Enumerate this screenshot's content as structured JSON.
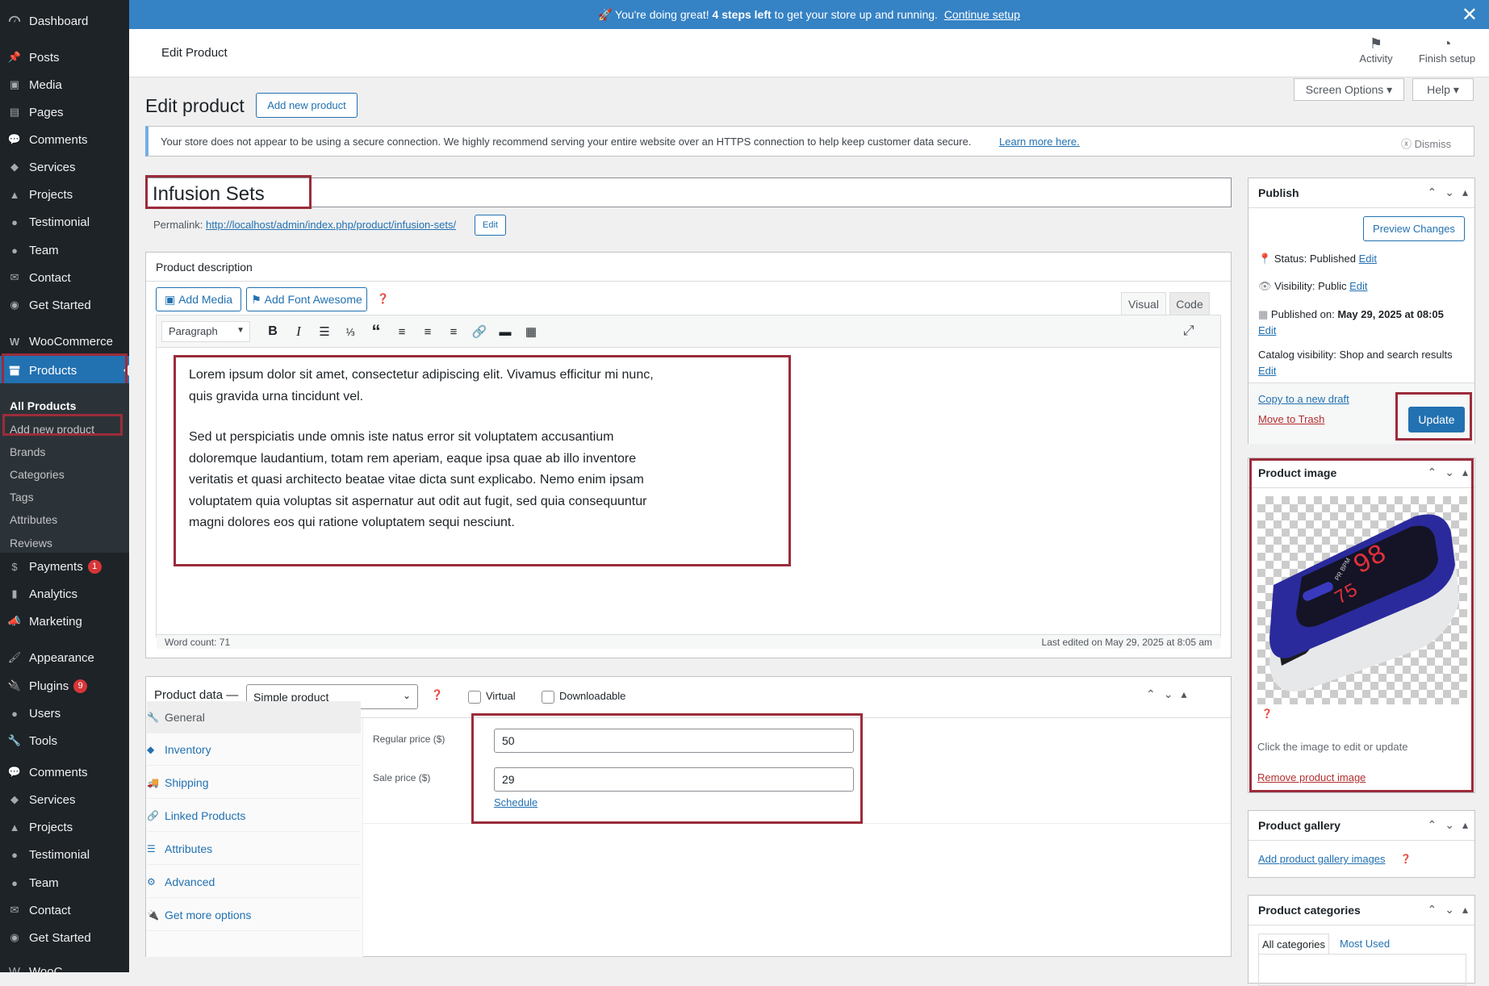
{
  "sidebar": {
    "top": [
      {
        "label": "Dashboard",
        "icon": "dashboard-icon"
      }
    ],
    "group1": [
      {
        "label": "Posts",
        "icon": "pin-icon"
      },
      {
        "label": "Media",
        "icon": "media-icon"
      },
      {
        "label": "Pages",
        "icon": "pages-icon"
      },
      {
        "label": "Comments",
        "icon": "comment-icon"
      },
      {
        "label": "Services",
        "icon": "tag-icon"
      },
      {
        "label": "Projects",
        "icon": "cap-icon"
      },
      {
        "label": "Testimonial",
        "icon": "person-icon"
      },
      {
        "label": "Team",
        "icon": "person-icon"
      },
      {
        "label": "Contact",
        "icon": "mail-icon"
      },
      {
        "label": "Get Started",
        "icon": "globe-icon"
      }
    ],
    "woo": "WooCommerce",
    "products": "Products",
    "products_sub": [
      "All Products",
      "Add new product",
      "Brands",
      "Categories",
      "Tags",
      "Attributes",
      "Reviews"
    ],
    "group2": [
      {
        "label": "Payments",
        "badge": "1"
      },
      {
        "label": "Analytics"
      },
      {
        "label": "Marketing"
      }
    ],
    "group3": [
      {
        "label": "Appearance"
      },
      {
        "label": "Plugins",
        "badge": "9"
      },
      {
        "label": "Users"
      },
      {
        "label": "Tools"
      }
    ],
    "group4": [
      {
        "label": "Comments"
      },
      {
        "label": "Services"
      },
      {
        "label": "Projects"
      },
      {
        "label": "Testimonial"
      },
      {
        "label": "Team"
      },
      {
        "label": "Contact"
      },
      {
        "label": "Get Started"
      }
    ],
    "bottom_cut": "WooC"
  },
  "banner": {
    "pre": "🚀 You're doing great! ",
    "bold": "4 steps left",
    "post": " to get your store up and running. ",
    "link": "Continue setup"
  },
  "header": {
    "title": "Edit Product",
    "activity": "Activity",
    "finish": "Finish setup"
  },
  "page": {
    "heading": "Edit product",
    "add_new": "Add new product",
    "screen_options": "Screen Options ▾",
    "help": "Help ▾"
  },
  "notice": {
    "text": "Your store does not appear to be using a secure connection. We highly recommend serving your entire website over an HTTPS connection to help keep customer data secure.",
    "link": "Learn more here.",
    "dismiss": "Dismiss"
  },
  "product": {
    "title": "Infusion Sets",
    "permalink_label": "Permalink:",
    "permalink": "http://localhost/admin/index.php/product/infusion-sets/",
    "edit": "Edit"
  },
  "desc": {
    "heading": "Product description",
    "add_media": "Add Media",
    "add_fa": "Add Font Awesome",
    "tab_visual": "Visual",
    "tab_code": "Code",
    "format": "Paragraph",
    "p1": "Lorem ipsum dolor sit amet, consectetur adipiscing elit. Vivamus efficitur mi nunc, quis gravida urna tincidunt vel.",
    "p2": "Sed ut perspiciatis unde omnis iste natus error sit voluptatem accusantium doloremque laudantium, totam rem aperiam, eaque ipsa quae ab illo inventore veritatis et quasi architecto beatae vitae dicta sunt explicabo. Nemo enim ipsam voluptatem quia voluptas sit aspernatur aut odit aut fugit, sed quia consequuntur magni dolores eos qui ratione voluptatem sequi nesciunt.",
    "word_count": "Word count: 71",
    "last_edited": "Last edited on May 29, 2025 at 8:05 am"
  },
  "pdata": {
    "heading": "Product data —",
    "type": "Simple product",
    "virtual": "Virtual",
    "downloadable": "Downloadable",
    "tabs": [
      "General",
      "Inventory",
      "Shipping",
      "Linked Products",
      "Attributes",
      "Advanced",
      "Get more options"
    ],
    "regular_label": "Regular price ($)",
    "regular": "50",
    "sale_label": "Sale price ($)",
    "sale": "29",
    "schedule": "Schedule"
  },
  "publish": {
    "heading": "Publish",
    "preview": "Preview Changes",
    "status_l": "Status: ",
    "status": "Published",
    "visibility_l": "Visibility: ",
    "visibility": "Public",
    "published_l": "Published on: ",
    "published": "May 29, 2025 at 08:05",
    "catalog_l": "Catalog visibility: ",
    "catalog": "Shop and search results",
    "edit": "Edit",
    "copy": "Copy to a new draft",
    "trash": "Move to Trash",
    "update": "Update"
  },
  "pimage": {
    "heading": "Product image",
    "hint": "Click the image to edit or update",
    "remove": "Remove product image",
    "display_top": "98",
    "display_bottom": "75",
    "display_label": "PR BPM"
  },
  "gallery": {
    "heading": "Product gallery",
    "add": "Add product gallery images"
  },
  "cats": {
    "heading": "Product categories",
    "all": "All categories",
    "most": "Most Used"
  },
  "colors": {
    "accent": "#2271b1",
    "sidebar": "#1d2327",
    "highlight": "#9b2c3b",
    "banner": "#3582c4"
  }
}
